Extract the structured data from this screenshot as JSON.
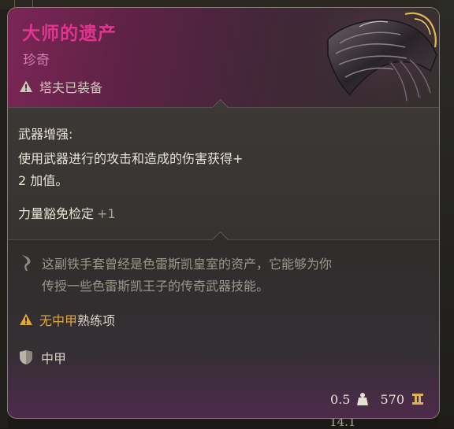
{
  "item": {
    "name": "大师的遗产",
    "rarity": "珍奇",
    "equipped_text": "塔夫已装备"
  },
  "effects": {
    "heading": "武器增强:",
    "lines": [
      "使用武器进行的攻击和造成的伤害获得+",
      "2 加值。"
    ],
    "save_label": "力量豁免检定",
    "save_bonus": "+1"
  },
  "lore": {
    "lines": [
      "这副铁手套曾经是色雷斯凯皇室的资产，它能够为你",
      "传授一些色雷斯凯王子的传奇武器技能。"
    ]
  },
  "proficiency": {
    "gold_part": "无中甲",
    "normal_part": "熟练项"
  },
  "armor_type": "中甲",
  "stats": {
    "weight": "0.5",
    "value": "570"
  },
  "background": {
    "version_text": "14.1"
  },
  "colors": {
    "title": "#e2338f",
    "rarity": "#d77db2",
    "proficiency_warning": "#dfa83e"
  },
  "icons": {
    "equipped": "warning-triangle-icon",
    "lore": "quill-icon",
    "proficiency": "warning-triangle-icon",
    "armor": "shield-icon",
    "weight": "weight-icon",
    "value": "gold-coin-icon"
  }
}
